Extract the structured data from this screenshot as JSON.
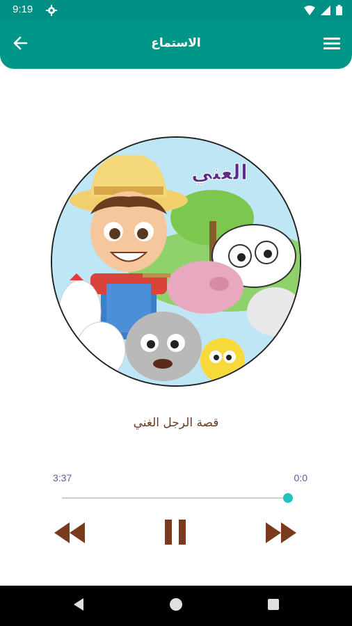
{
  "status_bar": {
    "time": "9:19",
    "icons": [
      "settings-icon",
      "wifi-icon",
      "signal-icon",
      "battery-icon"
    ]
  },
  "app_bar": {
    "title": "الاستماع",
    "back_icon": "arrow-left-icon",
    "menu_icon": "menu-icon"
  },
  "album_art": {
    "caption_text": "الغني",
    "description": "cartoon farmer with farm animals"
  },
  "track": {
    "title": "قصة الرجل الغني"
  },
  "player": {
    "elapsed_label": "3:37",
    "remaining_label": "0:0",
    "progress_fraction": 0.99,
    "controls": [
      "rewind-icon",
      "pause-icon",
      "fast-forward-icon"
    ]
  },
  "nav": {
    "buttons": [
      "back-triangle-icon",
      "home-circle-icon",
      "recents-square-icon"
    ]
  },
  "colors": {
    "primary": "#009688",
    "accent_text": "#6b3a22",
    "time_text": "#5a5aa8",
    "seek_thumb": "#20c3c0",
    "control": "#7a3a1e"
  }
}
